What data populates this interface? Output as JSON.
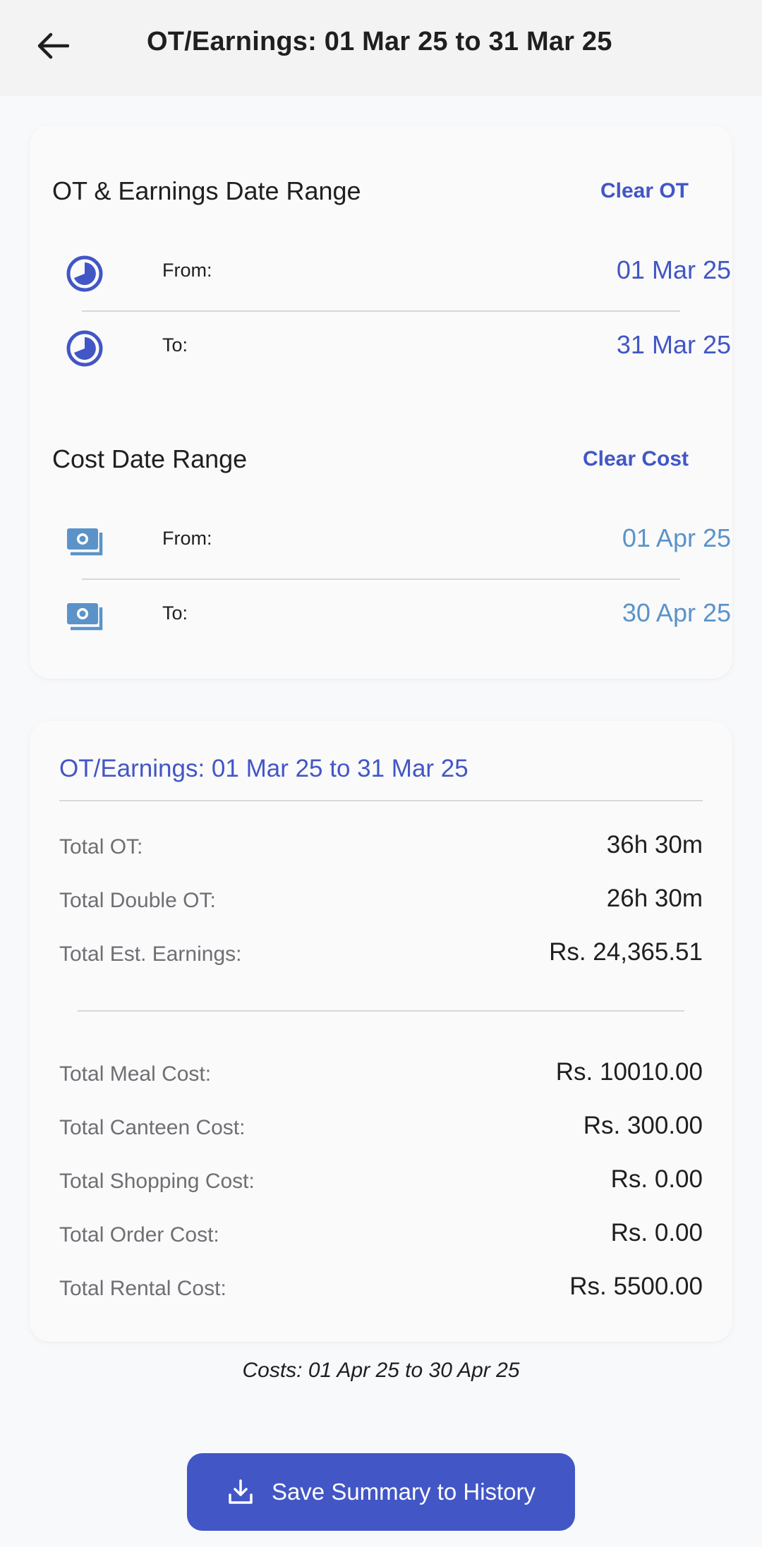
{
  "appbar": {
    "title": "OT/Earnings: 01 Mar 25 to 31 Mar 25"
  },
  "ot_range": {
    "title": "OT & Earnings Date Range",
    "clear_label": "Clear OT",
    "from_label": "From:",
    "from_value": "01 Mar 25",
    "to_label": "To:",
    "to_value": "31 Mar 25"
  },
  "cost_range": {
    "title": "Cost Date Range",
    "clear_label": "Clear Cost",
    "from_label": "From:",
    "from_value": "01 Apr 25",
    "to_label": "To:",
    "to_value": "30 Apr 25"
  },
  "summary": {
    "title": "OT/Earnings: 01 Mar 25 to 31 Mar 25",
    "earnings_rows": [
      {
        "label": "Total OT:",
        "value": "36h 30m"
      },
      {
        "label": "Total Double OT:",
        "value": "26h 30m"
      },
      {
        "label": "Total Est. Earnings:",
        "value": "Rs. 24,365.51"
      }
    ],
    "cost_rows": [
      {
        "label": "Total Meal Cost:",
        "value": "Rs. 10010.00"
      },
      {
        "label": "Total Canteen Cost:",
        "value": "Rs. 300.00"
      },
      {
        "label": "Total Shopping Cost:",
        "value": "Rs. 0.00"
      },
      {
        "label": "Total Order Cost:",
        "value": "Rs. 0.00"
      },
      {
        "label": "Total Rental Cost:",
        "value": "Rs. 5500.00"
      }
    ]
  },
  "cost_caption": "Costs: 01 Apr 25 to 30 Apr 25",
  "save_button": {
    "label": "Save Summary to History"
  },
  "colors": {
    "accent": "#4256c5",
    "cost_accent": "#5b93c9",
    "background": "#f8f9fb",
    "appbar": "#f3f3f3"
  },
  "icons": {
    "back": "arrow-left-icon",
    "ot_date": "clock-icon",
    "cost_date": "money-icon",
    "save": "download-icon"
  }
}
